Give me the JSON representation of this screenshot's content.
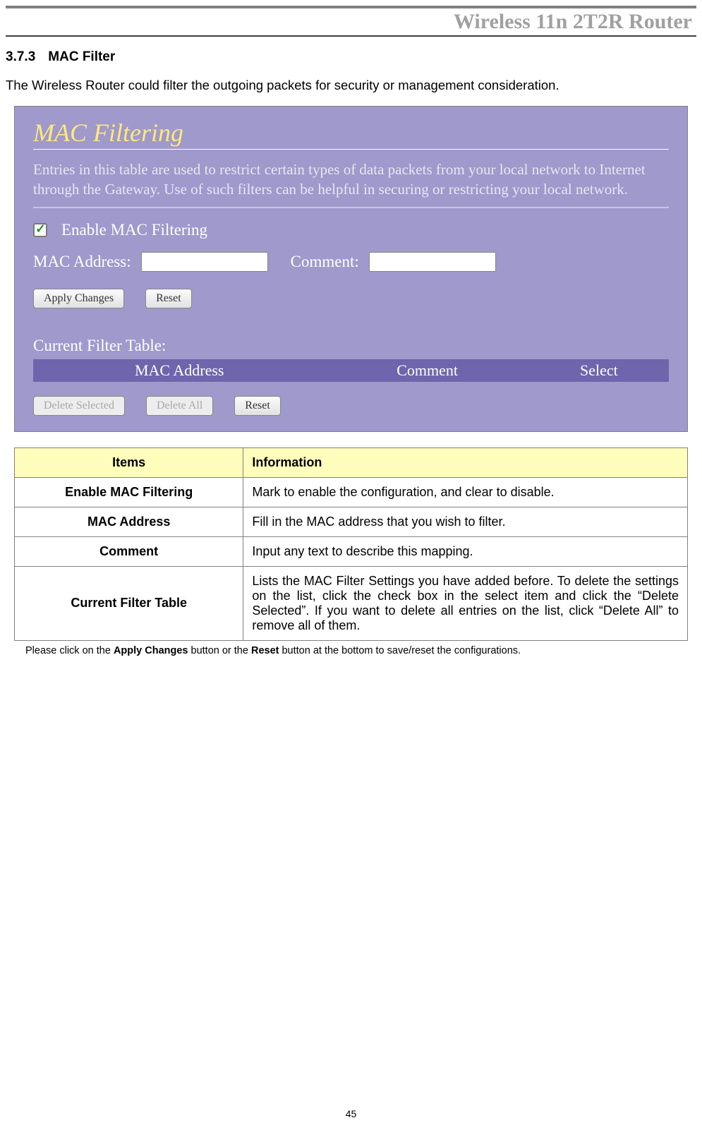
{
  "header": {
    "title": "Wireless 11n 2T2R Router"
  },
  "section": {
    "number": "3.7.3",
    "title": "MAC Filter"
  },
  "intro": "The Wireless Router could filter the outgoing packets for security or management consideration.",
  "screenshot": {
    "title": "MAC Filtering",
    "description": "Entries in this table are used to restrict certain types of data packets from your local network to Internet through the Gateway. Use of such filters can be helpful in securing or restricting your local network.",
    "enableLabel": "Enable MAC Filtering",
    "macAddrLabel": "MAC Address:",
    "commentLabel": "Comment:",
    "applyBtn": "Apply Changes",
    "resetBtn": "Reset",
    "tableHeading": "Current Filter Table:",
    "col1": "MAC Address",
    "col2": "Comment",
    "col3": "Select",
    "deleteSelectedBtn": "Delete Selected",
    "deleteAllBtn": "Delete All",
    "resetBtn2": "Reset"
  },
  "infoTable": {
    "headItems": "Items",
    "headInfo": "Information",
    "rows": [
      {
        "item": "Enable MAC Filtering",
        "info": "Mark to enable the configuration, and clear to disable."
      },
      {
        "item": "MAC Address",
        "info": "Fill in the MAC address that you wish to filter."
      },
      {
        "item": "Comment",
        "info": "Input any text to describe this mapping."
      },
      {
        "item": "Current Filter Table",
        "info": "Lists the MAC Filter Settings you have added before. To delete the settings on the list, click the check box in the select item and click the “Delete Selected”. If you want to delete all entries on the list, click “Delete All” to remove all of them."
      }
    ]
  },
  "footnote": {
    "prefix": "Please click on the ",
    "bold1": "Apply Changes",
    "mid": " button or the ",
    "bold2": "Reset",
    "suffix": " button at the bottom to save/reset the configurations."
  },
  "pageNumber": "45"
}
